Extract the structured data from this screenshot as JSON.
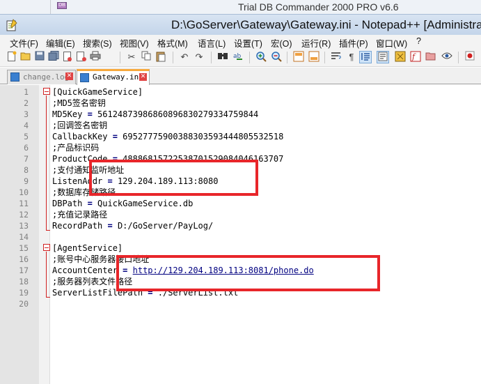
{
  "background_window": {
    "title": "Trial DB Commander 2000 PRO v6.6",
    "icon_label": "DB"
  },
  "window": {
    "title": "D:\\GoServer\\Gateway\\Gateway.ini - Notepad++ [Administrator]"
  },
  "menu": [
    "文件(F)",
    "编辑(E)",
    "搜索(S)",
    "视图(V)",
    "格式(M)",
    "语言(L)",
    "设置(T)",
    "宏(O)",
    "运行(R)",
    "插件(P)",
    "窗口(W)",
    "?"
  ],
  "tabs": [
    {
      "label": "change.log",
      "active": false
    },
    {
      "label": "Gateway.ini",
      "active": true
    }
  ],
  "lines": [
    {
      "n": "1",
      "type": "section",
      "text": "[QuickGameService]"
    },
    {
      "n": "2",
      "type": "comment",
      "text": ";MD5签名密钥"
    },
    {
      "n": "3",
      "type": "kv",
      "key": "MD5Key ",
      "value": " 561248739868608968302793347598​44"
    },
    {
      "n": "4",
      "type": "comment",
      "text": ";回调签名密钥"
    },
    {
      "n": "5",
      "type": "kv",
      "key": "CallbackKey ",
      "value": " 69527775900388303593444805532518"
    },
    {
      "n": "6",
      "type": "comment",
      "text": ";产品标识码"
    },
    {
      "n": "7",
      "type": "kv",
      "key": "ProductCode ",
      "value": " 48886815722538701529084046163707"
    },
    {
      "n": "8",
      "type": "comment",
      "text": ";支付通知监听地址"
    },
    {
      "n": "9",
      "type": "kv",
      "key": "ListenAddr ",
      "value": " 129.204.189.113:8080"
    },
    {
      "n": "10",
      "type": "comment",
      "text": ";数据库存储路径"
    },
    {
      "n": "11",
      "type": "kv",
      "key": "DBPath ",
      "value": " QuickGameService.db"
    },
    {
      "n": "12",
      "type": "comment",
      "text": ";充值记录路径"
    },
    {
      "n": "13",
      "type": "kv",
      "key": "RecordPath ",
      "value": " D:/GoServer/PayLog/"
    },
    {
      "n": "14",
      "type": "blank",
      "text": ""
    },
    {
      "n": "15",
      "type": "section",
      "text": "[AgentService]"
    },
    {
      "n": "16",
      "type": "comment",
      "text": ";账号中心服务器接口地址"
    },
    {
      "n": "17",
      "type": "kvurl",
      "key": "AccountCenter ",
      "value": "http://129.204.189.113:8081/phone.do"
    },
    {
      "n": "18",
      "type": "comment",
      "text": ";服务器列表文件路径"
    },
    {
      "n": "19",
      "type": "kv",
      "key": "ServerListFilePath ",
      "value": " ./ServerList.txt"
    },
    {
      "n": "20",
      "type": "blank",
      "text": ""
    }
  ]
}
